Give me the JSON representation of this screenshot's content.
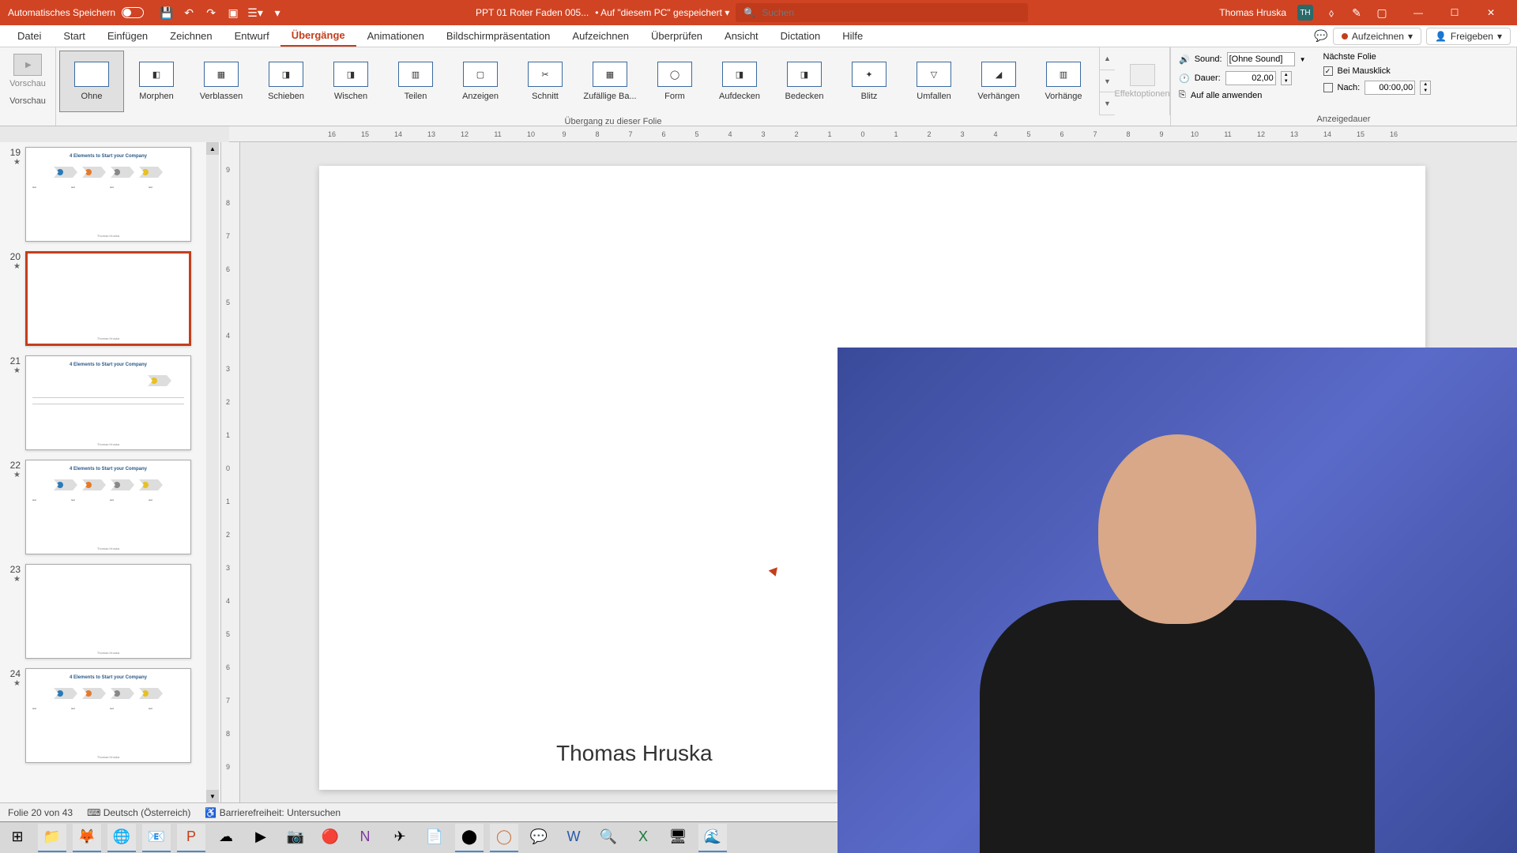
{
  "titlebar": {
    "autosave": "Automatisches Speichern",
    "filename": "PPT 01 Roter Faden 005...",
    "saved_location": "Auf \"diesem PC\" gespeichert",
    "search_placeholder": "Suchen",
    "username": "Thomas Hruska",
    "user_initials": "TH"
  },
  "tabs": {
    "items": [
      "Datei",
      "Start",
      "Einfügen",
      "Zeichnen",
      "Entwurf",
      "Übergänge",
      "Animationen",
      "Bildschirmpräsentation",
      "Aufzeichnen",
      "Überprüfen",
      "Ansicht",
      "Dictation",
      "Hilfe"
    ],
    "active_index": 5,
    "record": "Aufzeichnen",
    "share": "Freigeben"
  },
  "ribbon": {
    "preview": "Vorschau",
    "transitions": [
      "Ohne",
      "Morphen",
      "Verblassen",
      "Schieben",
      "Wischen",
      "Teilen",
      "Anzeigen",
      "Schnitt",
      "Zufällige Ba...",
      "Form",
      "Aufdecken",
      "Bedecken",
      "Blitz",
      "Umfallen",
      "Verhängen",
      "Vorhänge"
    ],
    "selected_transition_index": 0,
    "group_transition_label": "Übergang zu dieser Folie",
    "effect_options": "Effektoptionen",
    "sound_label": "Sound:",
    "sound_value": "[Ohne Sound]",
    "duration_label": "Dauer:",
    "duration_value": "02,00",
    "apply_all": "Auf alle anwenden",
    "advance": {
      "next_slide": "Nächste Folie",
      "on_click": "Bei Mausklick",
      "after_label": "Nach:",
      "after_value": "00:00,00"
    },
    "timing_label": "Anzeigedauer"
  },
  "ruler_h": [
    "16",
    "15",
    "14",
    "13",
    "12",
    "11",
    "10",
    "9",
    "8",
    "7",
    "6",
    "5",
    "4",
    "3",
    "2",
    "1",
    "0",
    "1",
    "2",
    "3",
    "4",
    "5",
    "6",
    "7",
    "8",
    "9",
    "10",
    "11",
    "12",
    "13",
    "14",
    "15",
    "16"
  ],
  "ruler_v": [
    "9",
    "8",
    "7",
    "6",
    "5",
    "4",
    "3",
    "2",
    "1",
    "0",
    "1",
    "2",
    "3",
    "4",
    "5",
    "6",
    "7",
    "8",
    "9"
  ],
  "thumbnails": {
    "items": [
      {
        "num": "19",
        "title": "4 Elements to Start your Company",
        "type": "full",
        "footer": "Thomas Hruska"
      },
      {
        "num": "20",
        "title": "",
        "type": "blank",
        "selected": true,
        "footer": "Thomas Hruska"
      },
      {
        "num": "21",
        "title": "4 Elements to Start your Company",
        "type": "single",
        "footer": "Thomas Hruska"
      },
      {
        "num": "22",
        "title": "4 Elements to Start your Company",
        "type": "full",
        "footer": "Thomas Hruska"
      },
      {
        "num": "23",
        "title": "",
        "type": "blank",
        "footer": "Thomas Hruska"
      },
      {
        "num": "24",
        "title": "4 Elements to Start your Company",
        "type": "full",
        "footer": "Thomas Hruska"
      }
    ]
  },
  "slide": {
    "author_text": "Thomas Hruska"
  },
  "statusbar": {
    "slide_info": "Folie 20 von 43",
    "language": "Deutsch (Österreich)",
    "accessibility": "Barrierefreiheit: Untersuchen"
  }
}
